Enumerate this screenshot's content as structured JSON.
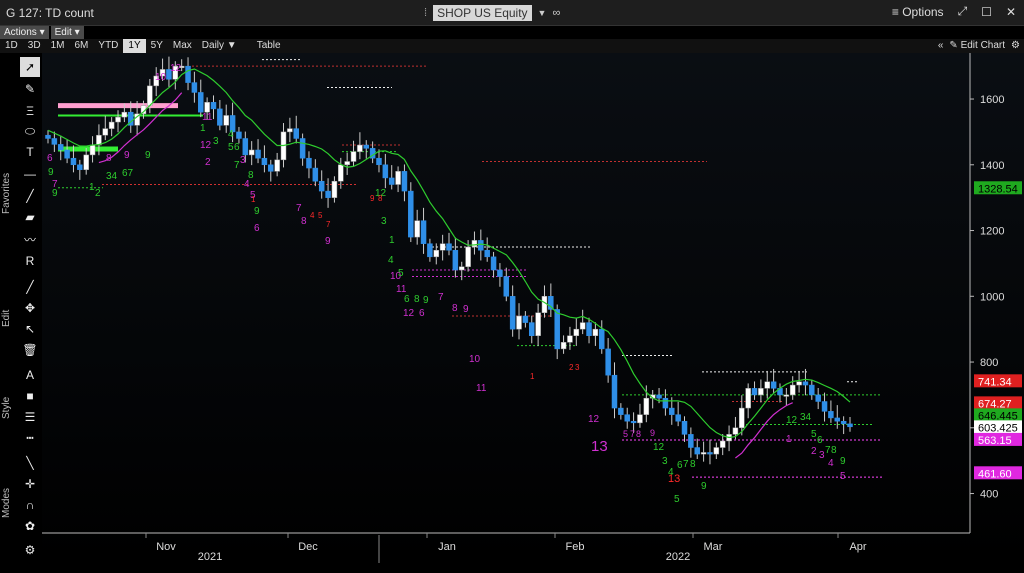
{
  "window": {
    "title": "G 127: TD count",
    "ticker": "SHOP US Equity",
    "options_label": "Options"
  },
  "menus": {
    "actions": "Actions ▾",
    "edit": "Edit ▾"
  },
  "ranges": [
    "1D",
    "3D",
    "1M",
    "6M",
    "YTD",
    "1Y",
    "5Y",
    "Max",
    "Daily ▼",
    "Table"
  ],
  "active_range": "1Y",
  "edit_chart_label": "Edit Chart",
  "toolbar": {
    "favorites_label": "Favorites",
    "edit_label": "Edit",
    "style_label": "Style",
    "modes_label": "Modes"
  },
  "colors": {
    "up_candle": "#ffffff",
    "down_candle": "#2f8fe8",
    "green": "#2ecc2e",
    "magenta": "#d030d0",
    "red": "#ff2a2a",
    "label_red": "#ff0000",
    "label_green": "#22cc22",
    "label_pink": "#ff44ff"
  },
  "chart_data": {
    "type": "candlestick",
    "ylim": [
      280,
      1740
    ],
    "yticks": [
      400,
      600,
      800,
      1000,
      1200,
      1400,
      1600
    ],
    "x_months": [
      "Nov",
      "Dec",
      "Jan",
      "Feb",
      "Mar",
      "Apr"
    ],
    "x_years": [
      "2021",
      "2022"
    ],
    "price_labels": [
      {
        "value": 1328.54,
        "text": "1328.54",
        "color": "green"
      },
      {
        "value": 741.34,
        "text": "741.34",
        "color": "red"
      },
      {
        "value": 674.27,
        "text": "674.27",
        "color": "red"
      },
      {
        "value": 646.445,
        "text": "646.445",
        "color": "green"
      },
      {
        "value": 603.425,
        "text": "603.425",
        "color": "white"
      },
      {
        "value": 563.15,
        "text": "563.15",
        "color": "pink"
      },
      {
        "value": 461.6,
        "text": "461.60",
        "color": "pink"
      }
    ],
    "closes": [
      1480,
      1462,
      1445,
      1420,
      1400,
      1385,
      1430,
      1460,
      1490,
      1510,
      1530,
      1545,
      1560,
      1520,
      1555,
      1580,
      1640,
      1670,
      1690,
      1660,
      1700,
      1700,
      1650,
      1620,
      1560,
      1590,
      1570,
      1520,
      1550,
      1500,
      1480,
      1430,
      1445,
      1420,
      1400,
      1380,
      1415,
      1500,
      1510,
      1480,
      1420,
      1390,
      1350,
      1320,
      1300,
      1350,
      1400,
      1410,
      1440,
      1460,
      1450,
      1420,
      1400,
      1360,
      1340,
      1380,
      1320,
      1180,
      1230,
      1160,
      1120,
      1140,
      1160,
      1140,
      1080,
      1090,
      1150,
      1170,
      1140,
      1120,
      1080,
      1060,
      1000,
      900,
      940,
      920,
      880,
      950,
      1000,
      960,
      840,
      860,
      880,
      900,
      920,
      880,
      900,
      840,
      760,
      660,
      640,
      620,
      615,
      640,
      690,
      700,
      690,
      660,
      640,
      620,
      580,
      540,
      520,
      525,
      520,
      540,
      560,
      580,
      600,
      660,
      720,
      700,
      720,
      740,
      720,
      700,
      700,
      730,
      740,
      730,
      700,
      680,
      650,
      630,
      620,
      612,
      603
    ]
  },
  "td_labels": [
    {
      "x": 5,
      "y": 97,
      "t": "6",
      "c": "magenta",
      "s": 10
    },
    {
      "x": 6,
      "y": 111,
      "t": "9",
      "c": "green",
      "s": 10
    },
    {
      "x": 10,
      "y": 123,
      "t": "7",
      "c": "magenta",
      "s": 10
    },
    {
      "x": 10,
      "y": 132,
      "t": "9",
      "c": "green",
      "s": 10
    },
    {
      "x": 64,
      "y": 97,
      "t": "8",
      "c": "magenta",
      "s": 10
    },
    {
      "x": 82,
      "y": 94,
      "t": "9",
      "c": "magenta",
      "s": 10
    },
    {
      "x": 103,
      "y": 94,
      "t": "9",
      "c": "green",
      "s": 10
    },
    {
      "x": 64,
      "y": 115,
      "t": "34",
      "c": "green",
      "s": 10
    },
    {
      "x": 80,
      "y": 112,
      "t": "67",
      "c": "green",
      "s": 10
    },
    {
      "x": 47,
      "y": 126,
      "t": "1",
      "c": "green",
      "s": 10
    },
    {
      "x": 53,
      "y": 132,
      "t": "2",
      "c": "green",
      "s": 10
    },
    {
      "x": 113,
      "y": 16,
      "t": "10",
      "c": "magenta",
      "s": 10
    },
    {
      "x": 128,
      "y": 7,
      "t": "12",
      "c": "magenta",
      "s": 10
    },
    {
      "x": 160,
      "y": 56,
      "t": "11",
      "c": "magenta",
      "s": 10
    },
    {
      "x": 158,
      "y": 67,
      "t": "1",
      "c": "green",
      "s": 10
    },
    {
      "x": 158,
      "y": 84,
      "t": "12",
      "c": "magenta",
      "s": 10
    },
    {
      "x": 171,
      "y": 80,
      "t": "3",
      "c": "green",
      "s": 10
    },
    {
      "x": 186,
      "y": 73,
      "t": "4",
      "c": "green",
      "s": 10
    },
    {
      "x": 186,
      "y": 86,
      "t": "5",
      "c": "green",
      "s": 10
    },
    {
      "x": 192,
      "y": 86,
      "t": "6",
      "c": "green",
      "s": 10
    },
    {
      "x": 198,
      "y": 99,
      "t": "3",
      "c": "magenta",
      "s": 10
    },
    {
      "x": 192,
      "y": 104,
      "t": "7",
      "c": "green",
      "s": 10
    },
    {
      "x": 163,
      "y": 101,
      "t": "2",
      "c": "magenta",
      "s": 10
    },
    {
      "x": 206,
      "y": 114,
      "t": "8",
      "c": "green",
      "s": 10
    },
    {
      "x": 202,
      "y": 123,
      "t": "4",
      "c": "magenta",
      "s": 10
    },
    {
      "x": 208,
      "y": 134,
      "t": "5",
      "c": "magenta",
      "s": 10
    },
    {
      "x": 212,
      "y": 150,
      "t": "9",
      "c": "green",
      "s": 10
    },
    {
      "x": 212,
      "y": 167,
      "t": "6",
      "c": "magenta",
      "s": 10
    },
    {
      "x": 254,
      "y": 147,
      "t": "7",
      "c": "magenta",
      "s": 10
    },
    {
      "x": 259,
      "y": 160,
      "t": "8",
      "c": "magenta",
      "s": 10
    },
    {
      "x": 283,
      "y": 180,
      "t": "9",
      "c": "magenta",
      "s": 10
    },
    {
      "x": 333,
      "y": 132,
      "t": "12",
      "c": "green",
      "s": 10
    },
    {
      "x": 339,
      "y": 160,
      "t": "3",
      "c": "green",
      "s": 10
    },
    {
      "x": 347,
      "y": 179,
      "t": "1",
      "c": "green",
      "s": 10
    },
    {
      "x": 346,
      "y": 199,
      "t": "4",
      "c": "green",
      "s": 10
    },
    {
      "x": 348,
      "y": 215,
      "t": "10",
      "c": "magenta",
      "s": 10
    },
    {
      "x": 356,
      "y": 212,
      "t": "5",
      "c": "green",
      "s": 10
    },
    {
      "x": 354,
      "y": 228,
      "t": "11",
      "c": "magenta",
      "s": 10
    },
    {
      "x": 362,
      "y": 238,
      "t": "6",
      "c": "green",
      "s": 10
    },
    {
      "x": 372,
      "y": 238,
      "t": "8",
      "c": "green",
      "s": 10
    },
    {
      "x": 381,
      "y": 239,
      "t": "9",
      "c": "green",
      "s": 10
    },
    {
      "x": 361,
      "y": 252,
      "t": "12",
      "c": "magenta",
      "s": 10
    },
    {
      "x": 377,
      "y": 252,
      "t": "6",
      "c": "magenta",
      "s": 10
    },
    {
      "x": 396,
      "y": 236,
      "t": "7",
      "c": "magenta",
      "s": 10
    },
    {
      "x": 410,
      "y": 247,
      "t": "8",
      "c": "magenta",
      "s": 10
    },
    {
      "x": 421,
      "y": 248,
      "t": "9",
      "c": "magenta",
      "s": 10
    },
    {
      "x": 427,
      "y": 298,
      "t": "10",
      "c": "magenta",
      "s": 10
    },
    {
      "x": 434,
      "y": 327,
      "t": "11",
      "c": "magenta",
      "s": 10
    },
    {
      "x": 546,
      "y": 358,
      "t": "12",
      "c": "magenta",
      "s": 10
    },
    {
      "x": 581,
      "y": 373,
      "t": "5",
      "c": "magenta",
      "s": 9
    },
    {
      "x": 588,
      "y": 373,
      "t": "7",
      "c": "magenta",
      "s": 9
    },
    {
      "x": 594,
      "y": 373,
      "t": "8",
      "c": "magenta",
      "s": 9
    },
    {
      "x": 549,
      "y": 387,
      "t": "13",
      "c": "magenta",
      "s": 15
    },
    {
      "x": 608,
      "y": 372,
      "t": "9",
      "c": "magenta",
      "s": 9
    },
    {
      "x": 611,
      "y": 386,
      "t": "12",
      "c": "green",
      "s": 10
    },
    {
      "x": 620,
      "y": 400,
      "t": "3",
      "c": "green",
      "s": 10
    },
    {
      "x": 626,
      "y": 411,
      "t": "4",
      "c": "green",
      "s": 10
    },
    {
      "x": 635,
      "y": 404,
      "t": "6",
      "c": "green",
      "s": 10
    },
    {
      "x": 641,
      "y": 403,
      "t": "7",
      "c": "green",
      "s": 10
    },
    {
      "x": 648,
      "y": 403,
      "t": "8",
      "c": "green",
      "s": 10
    },
    {
      "x": 626,
      "y": 418,
      "t": "13",
      "c": "red",
      "s": 11
    },
    {
      "x": 632,
      "y": 438,
      "t": "5",
      "c": "green",
      "s": 10
    },
    {
      "x": 659,
      "y": 425,
      "t": "9",
      "c": "green",
      "s": 10
    },
    {
      "x": 744,
      "y": 359,
      "t": "12",
      "c": "green",
      "s": 10
    },
    {
      "x": 758,
      "y": 356,
      "t": "34",
      "c": "green",
      "s": 10
    },
    {
      "x": 744,
      "y": 378,
      "t": "1",
      "c": "magenta",
      "s": 10
    },
    {
      "x": 769,
      "y": 373,
      "t": "5",
      "c": "green",
      "s": 10
    },
    {
      "x": 775,
      "y": 379,
      "t": "6",
      "c": "green",
      "s": 10
    },
    {
      "x": 783,
      "y": 389,
      "t": "7",
      "c": "green",
      "s": 10
    },
    {
      "x": 789,
      "y": 389,
      "t": "8",
      "c": "green",
      "s": 10
    },
    {
      "x": 769,
      "y": 390,
      "t": "2",
      "c": "magenta",
      "s": 10
    },
    {
      "x": 777,
      "y": 394,
      "t": "3",
      "c": "magenta",
      "s": 10
    },
    {
      "x": 786,
      "y": 402,
      "t": "4",
      "c": "magenta",
      "s": 10
    },
    {
      "x": 798,
      "y": 400,
      "t": "9",
      "c": "green",
      "s": 10
    },
    {
      "x": 798,
      "y": 415,
      "t": "5",
      "c": "magenta",
      "s": 10
    },
    {
      "x": 488,
      "y": 315,
      "t": "1",
      "c": "red",
      "s": 8
    },
    {
      "x": 527,
      "y": 306,
      "t": "2",
      "c": "red",
      "s": 8
    },
    {
      "x": 533,
      "y": 306,
      "t": "3",
      "c": "red",
      "s": 8
    },
    {
      "x": 209,
      "y": 138,
      "t": "1",
      "c": "red",
      "s": 8
    },
    {
      "x": 268,
      "y": 154,
      "t": "4",
      "c": "red",
      "s": 8
    },
    {
      "x": 276,
      "y": 154,
      "t": "5",
      "c": "red",
      "s": 8
    },
    {
      "x": 284,
      "y": 163,
      "t": "7",
      "c": "red",
      "s": 8
    },
    {
      "x": 328,
      "y": 137,
      "t": "9",
      "c": "red",
      "s": 8
    },
    {
      "x": 336,
      "y": 137,
      "t": "8",
      "c": "red",
      "s": 8
    }
  ]
}
